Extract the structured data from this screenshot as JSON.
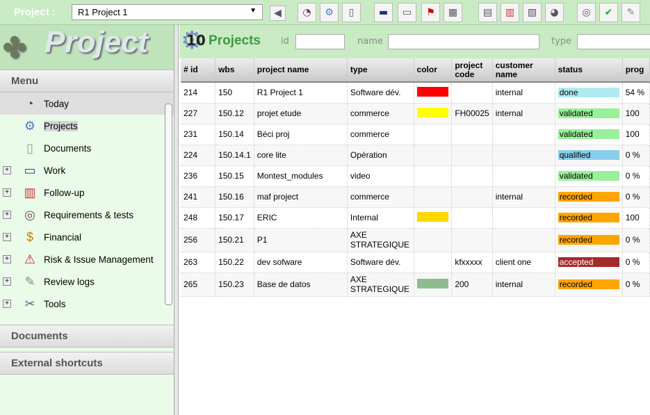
{
  "topbar": {
    "project_label": "Project :",
    "project_value": "R1 Project 1",
    "buttons": [
      "back-icon",
      "today-icon",
      "projects-icon",
      "documents-icon",
      "ticket-icon",
      "work-icon",
      "flag-icon",
      "clapper-icon",
      "followup-icon",
      "planning-icon",
      "gantt-icon",
      "chart-icon",
      "requirements-icon",
      "check-icon",
      "review-icon"
    ]
  },
  "logo": "Project",
  "menu": {
    "title": "Menu",
    "items": [
      {
        "label": "Today",
        "icon": "today-icon",
        "expandable": false
      },
      {
        "label": "Projects",
        "icon": "gear-icon",
        "expandable": false
      },
      {
        "label": "Documents",
        "icon": "document-icon",
        "expandable": false
      },
      {
        "label": "Work",
        "icon": "computer-icon",
        "expandable": true
      },
      {
        "label": "Follow-up",
        "icon": "planning-icon",
        "expandable": true
      },
      {
        "label": "Requirements & tests",
        "icon": "target-icon",
        "expandable": true
      },
      {
        "label": "Financial",
        "icon": "money-bag-icon",
        "expandable": true
      },
      {
        "label": "Risk & Issue Management",
        "icon": "warning-icon",
        "expandable": true
      },
      {
        "label": "Review logs",
        "icon": "review-icon",
        "expandable": true
      },
      {
        "label": "Tools",
        "icon": "tools-icon",
        "expandable": true
      }
    ]
  },
  "sections": {
    "documents": "Documents",
    "external": "External shortcuts"
  },
  "main": {
    "count": "10",
    "title": "Projects",
    "filters": {
      "id": "id",
      "name": "name",
      "type": "type"
    }
  },
  "table": {
    "headers": [
      "# id",
      "wbs",
      "project name",
      "type",
      "color",
      "project code",
      "customer name",
      "status",
      "prog"
    ],
    "rows": [
      {
        "id": "214",
        "wbs": "150",
        "name": "R1 Project 1",
        "type": "Software dév.",
        "color": "#ff0000",
        "code": "",
        "customer": "internal",
        "status": "done",
        "status_color": "#aeeaf0",
        "progress": "54 %"
      },
      {
        "id": "227",
        "wbs": "150.12",
        "name": "projet etude",
        "type": "commerce",
        "color": "#ffff00",
        "code": "FH00025",
        "customer": "internal",
        "status": "validated",
        "status_color": "#98f098",
        "progress": "100"
      },
      {
        "id": "231",
        "wbs": "150.14",
        "name": "Béci proj",
        "type": "commerce",
        "color": "",
        "code": "",
        "customer": "",
        "status": "validated",
        "status_color": "#98f098",
        "progress": "100"
      },
      {
        "id": "224",
        "wbs": "150.14.1",
        "name": "core lite",
        "type": "Opération",
        "color": "",
        "code": "",
        "customer": "",
        "status": "qualified",
        "status_color": "#87ceeb",
        "progress": "0 %"
      },
      {
        "id": "236",
        "wbs": "150.15",
        "name": "Montest_modules",
        "type": "video",
        "color": "",
        "code": "",
        "customer": "",
        "status": "validated",
        "status_color": "#98f098",
        "progress": "0 %"
      },
      {
        "id": "241",
        "wbs": "150.16",
        "name": "maf project",
        "type": "commerce",
        "color": "",
        "code": "",
        "customer": "internal",
        "status": "recorded",
        "status_color": "#ffa500",
        "progress": "0 %"
      },
      {
        "id": "248",
        "wbs": "150.17",
        "name": "ERIC",
        "type": "Internal",
        "color": "#ffd700",
        "code": "",
        "customer": "",
        "status": "recorded",
        "status_color": "#ffa500",
        "progress": "100"
      },
      {
        "id": "256",
        "wbs": "150.21",
        "name": "P1",
        "type": "AXE STRATEGIQUE",
        "color": "",
        "code": "",
        "customer": "",
        "status": "recorded",
        "status_color": "#ffa500",
        "progress": "0 %"
      },
      {
        "id": "263",
        "wbs": "150.22",
        "name": "dev sofware",
        "type": "Software dév.",
        "color": "",
        "code": "kfxxxxx",
        "customer": "client one",
        "status": "accepted",
        "status_color": "#a52a2a",
        "progress": "0 %"
      },
      {
        "id": "265",
        "wbs": "150.23",
        "name": "Base de datos",
        "type": "AXE STRATEGIQUE",
        "color": "#8fbc8f",
        "code": "200",
        "customer": "internal",
        "status": "recorded",
        "status_color": "#ffa500",
        "progress": "0 %"
      }
    ]
  }
}
